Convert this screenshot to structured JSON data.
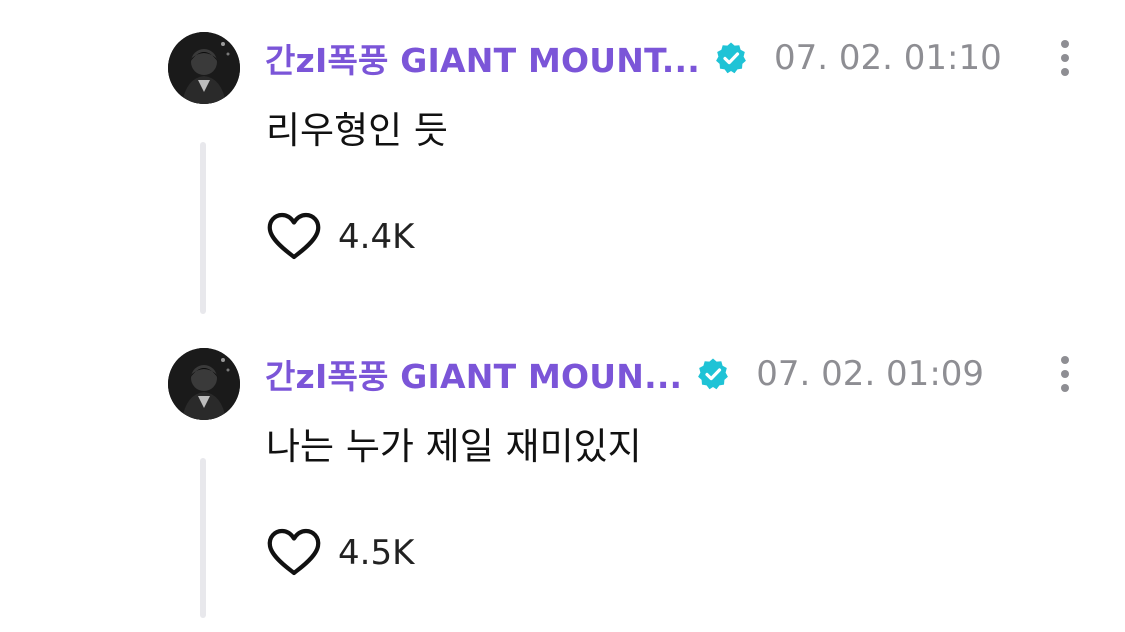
{
  "comments": [
    {
      "username": "간zI폭풍 GIANT MOUNT...",
      "timestamp": "07. 02. 01:10",
      "text": "리우형인 듯",
      "likes": "4.4K",
      "avatar_icon": "user-avatar-photo"
    },
    {
      "username": "간zI폭풍 GIANT MOUN...",
      "timestamp": "07. 02. 01:09",
      "text": "나는 누가 제일 재미있지",
      "likes": "4.5K",
      "avatar_icon": "user-avatar-photo"
    }
  ],
  "colors": {
    "username": "#7b55d8",
    "verified_badge": "#1fc3d6",
    "timestamp": "#8e8e93",
    "thread_line": "#e8e8ec",
    "text": "#111111"
  },
  "icons": {
    "verified": "verified-badge-icon",
    "more": "more-vertical-icon",
    "like": "heart-outline-icon"
  }
}
